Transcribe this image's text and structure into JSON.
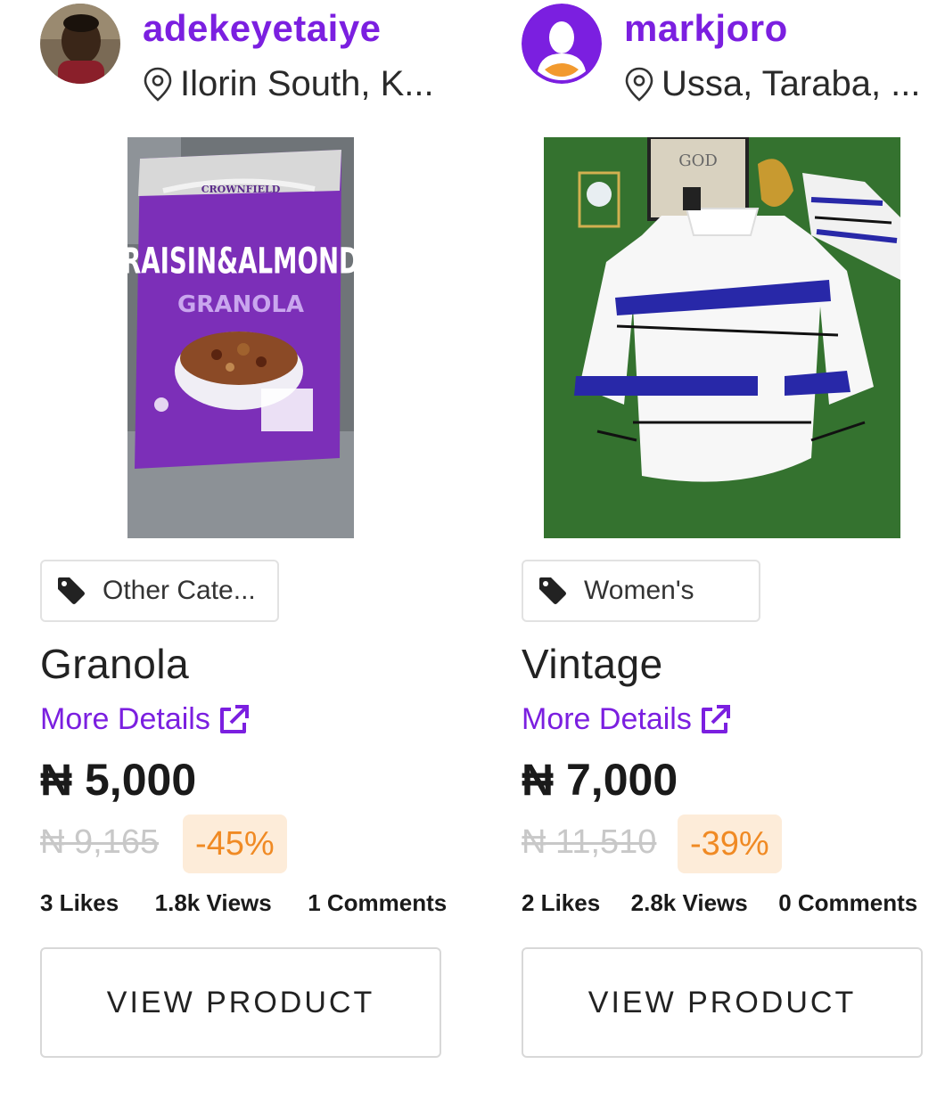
{
  "products": [
    {
      "seller": {
        "username": "adekeyetaiye",
        "location": "Ilorin South, K...",
        "avatar_icon": "user-photo"
      },
      "category": "Other Cate...",
      "title": "Granola",
      "more_details": "More Details",
      "price": "₦ 5,000",
      "old_price": "₦ 9,165",
      "discount": "-45%",
      "stats": {
        "likes": "3 Likes",
        "views": "1.8k Views",
        "comments": "1 Comments"
      },
      "button_label": "VIEW PRODUCT",
      "image_text": {
        "brand": "CROWNFIELD",
        "line1": "RAISIN&ALMOND",
        "line2": "GRANOLA"
      }
    },
    {
      "seller": {
        "username": "markjoro",
        "location": "Ussa, Taraba, ...",
        "avatar_icon": "default-avatar"
      },
      "category": "Women's",
      "title": "Vintage",
      "more_details": "More Details",
      "price": "₦ 7,000",
      "old_price": "₦ 11,510",
      "discount": "-39%",
      "stats": {
        "likes": "2 Likes",
        "views": "2.8k Views",
        "comments": "0 Comments"
      },
      "button_label": "VIEW PRODUCT",
      "image_text": {
        "sign": "GOD"
      }
    }
  ],
  "colors": {
    "accent": "#7b1fe0",
    "discount_text": "#f08a24",
    "discount_bg": "#fdecd9",
    "old_price": "#c8c8c8"
  }
}
